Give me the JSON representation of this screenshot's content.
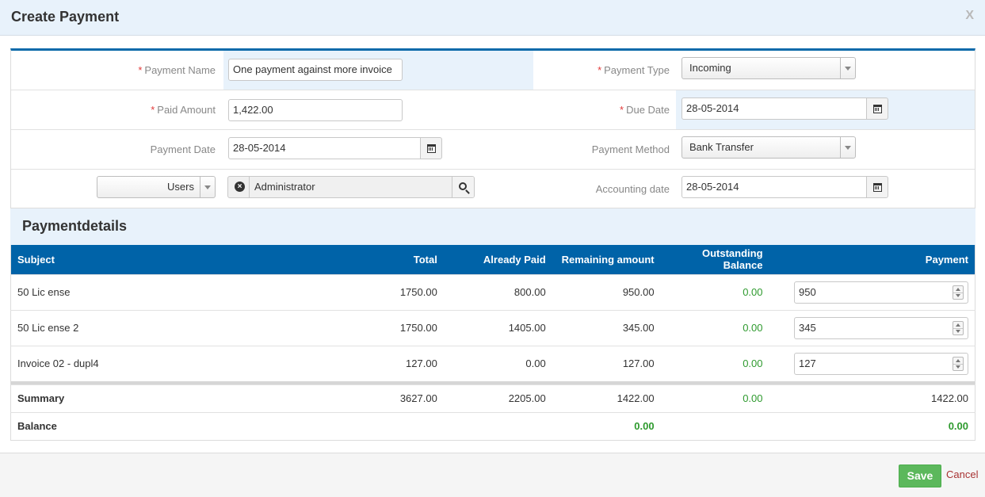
{
  "header": {
    "title": "Create Payment",
    "close": "X"
  },
  "form": {
    "payment_name": {
      "label": "Payment Name",
      "value": "One payment against more invoice"
    },
    "payment_type": {
      "label": "Payment Type",
      "value": "Incoming"
    },
    "paid_amount": {
      "label": "Paid Amount",
      "value": "1,422.00"
    },
    "due_date": {
      "label": "Due Date",
      "value": "28-05-2014"
    },
    "payment_date": {
      "label": "Payment Date",
      "value": "28-05-2014"
    },
    "payment_method": {
      "label": "Payment Method",
      "value": "Bank Transfer"
    },
    "assignee_type": {
      "value": "Users"
    },
    "assignee": {
      "value": "Administrator"
    },
    "accounting_date": {
      "label": "Accounting date",
      "value": "28-05-2014"
    }
  },
  "section": {
    "title": "Paymentdetails"
  },
  "table": {
    "columns": [
      "Subject",
      "Total",
      "Already Paid",
      "Remaining amount",
      "Outstanding Balance",
      "Payment"
    ],
    "rows": [
      {
        "subject": "50 Lic ense",
        "total": "1750.00",
        "already_paid": "800.00",
        "remaining": "950.00",
        "outstanding": "0.00",
        "payment": "950"
      },
      {
        "subject": "50 Lic ense 2",
        "total": "1750.00",
        "already_paid": "1405.00",
        "remaining": "345.00",
        "outstanding": "0.00",
        "payment": "345"
      },
      {
        "subject": "Invoice 02 - dupl4",
        "total": "127.00",
        "already_paid": "0.00",
        "remaining": "127.00",
        "outstanding": "0.00",
        "payment": "127"
      }
    ],
    "summary": {
      "label": "Summary",
      "total": "3627.00",
      "already_paid": "2205.00",
      "remaining": "1422.00",
      "outstanding": "0.00",
      "payment": "1422.00"
    },
    "balance": {
      "label": "Balance",
      "remaining": "0.00",
      "payment": "0.00"
    }
  },
  "footer": {
    "save": "Save",
    "cancel": "Cancel"
  },
  "colors": {
    "accent": "#0063a8",
    "save_green": "#5cb85c",
    "cancel_red": "#a83232",
    "positive_green": "#2e9a2e"
  }
}
